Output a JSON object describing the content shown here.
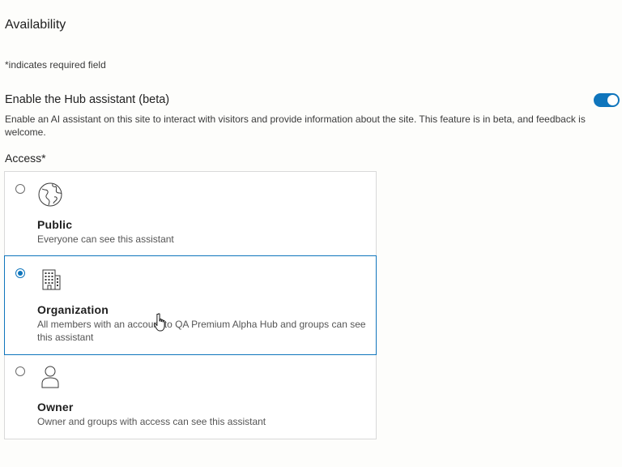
{
  "section": {
    "title": "Availability",
    "required_note": "*indicates required field"
  },
  "assistant_toggle": {
    "label": "Enable the Hub assistant (beta)",
    "enabled": true,
    "description": "Enable an AI assistant on this site to interact with visitors and provide information about the site. This feature is in beta, and feedback is welcome."
  },
  "access": {
    "label": "Access*",
    "selected": "organization",
    "options": [
      {
        "id": "public",
        "icon": "globe-icon",
        "title": "Public",
        "description": "Everyone can see this assistant"
      },
      {
        "id": "organization",
        "icon": "building-icon",
        "title": "Organization",
        "description": "All members with an account to QA Premium Alpha Hub and groups can see this assistant"
      },
      {
        "id": "owner",
        "icon": "user-icon",
        "title": "Owner",
        "description": "Owner and groups with access can see this assistant"
      }
    ]
  },
  "colors": {
    "accent": "#0f75bc",
    "border": "#d9d9d9",
    "background": "#fdfdfb"
  }
}
